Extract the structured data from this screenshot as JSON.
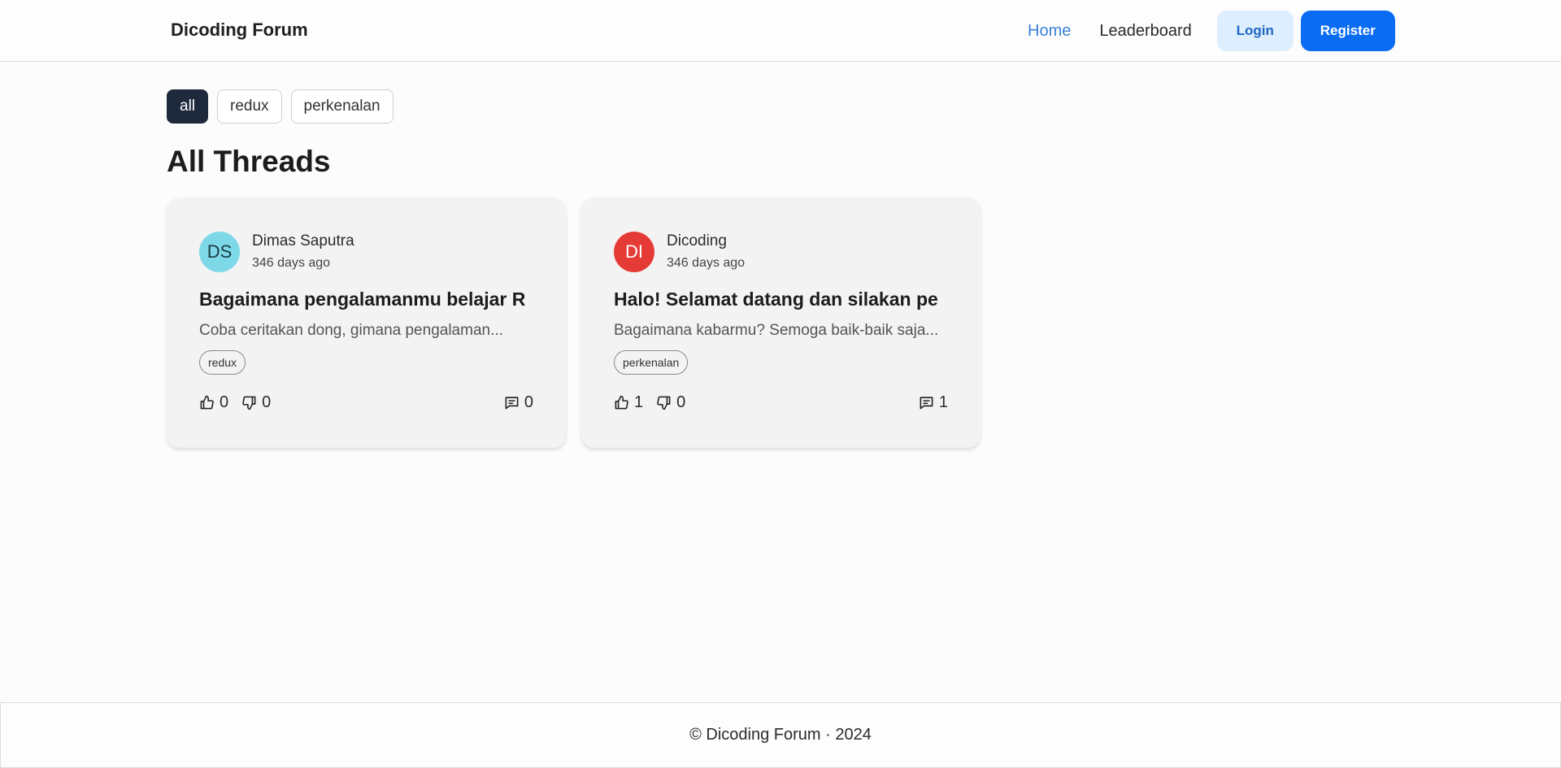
{
  "header": {
    "brand": "Dicoding Forum",
    "nav": {
      "home": "Home",
      "leaderboard": "Leaderboard"
    },
    "login_label": "Login",
    "register_label": "Register",
    "active_link_color": "#3b82d6"
  },
  "filters": [
    "all",
    "redux",
    "perkenalan"
  ],
  "active_filter": "all",
  "page_title": "All Threads",
  "threads": [
    {
      "avatar_initials": "DS",
      "avatar_color": "#7dd9e8",
      "owner": "Dimas Saputra",
      "created": "346 days ago",
      "title": "Bagaimana pengalamanmu belajar R",
      "body": "Coba ceritakan dong, gimana pengalaman...",
      "category": "redux",
      "upvotes": "0",
      "downvotes": "0",
      "comments": "0"
    },
    {
      "avatar_initials": "DI",
      "avatar_color": "#e53b37",
      "owner": "Dicoding",
      "created": "346 days ago",
      "title": "Halo! Selamat datang dan silakan pe",
      "body": "Bagaimana kabarmu? Semoga baik-baik saja...",
      "category": "perkenalan",
      "upvotes": "1",
      "downvotes": "0",
      "comments": "1"
    }
  ],
  "footer": {
    "text": "© Dicoding Forum · 2024"
  }
}
